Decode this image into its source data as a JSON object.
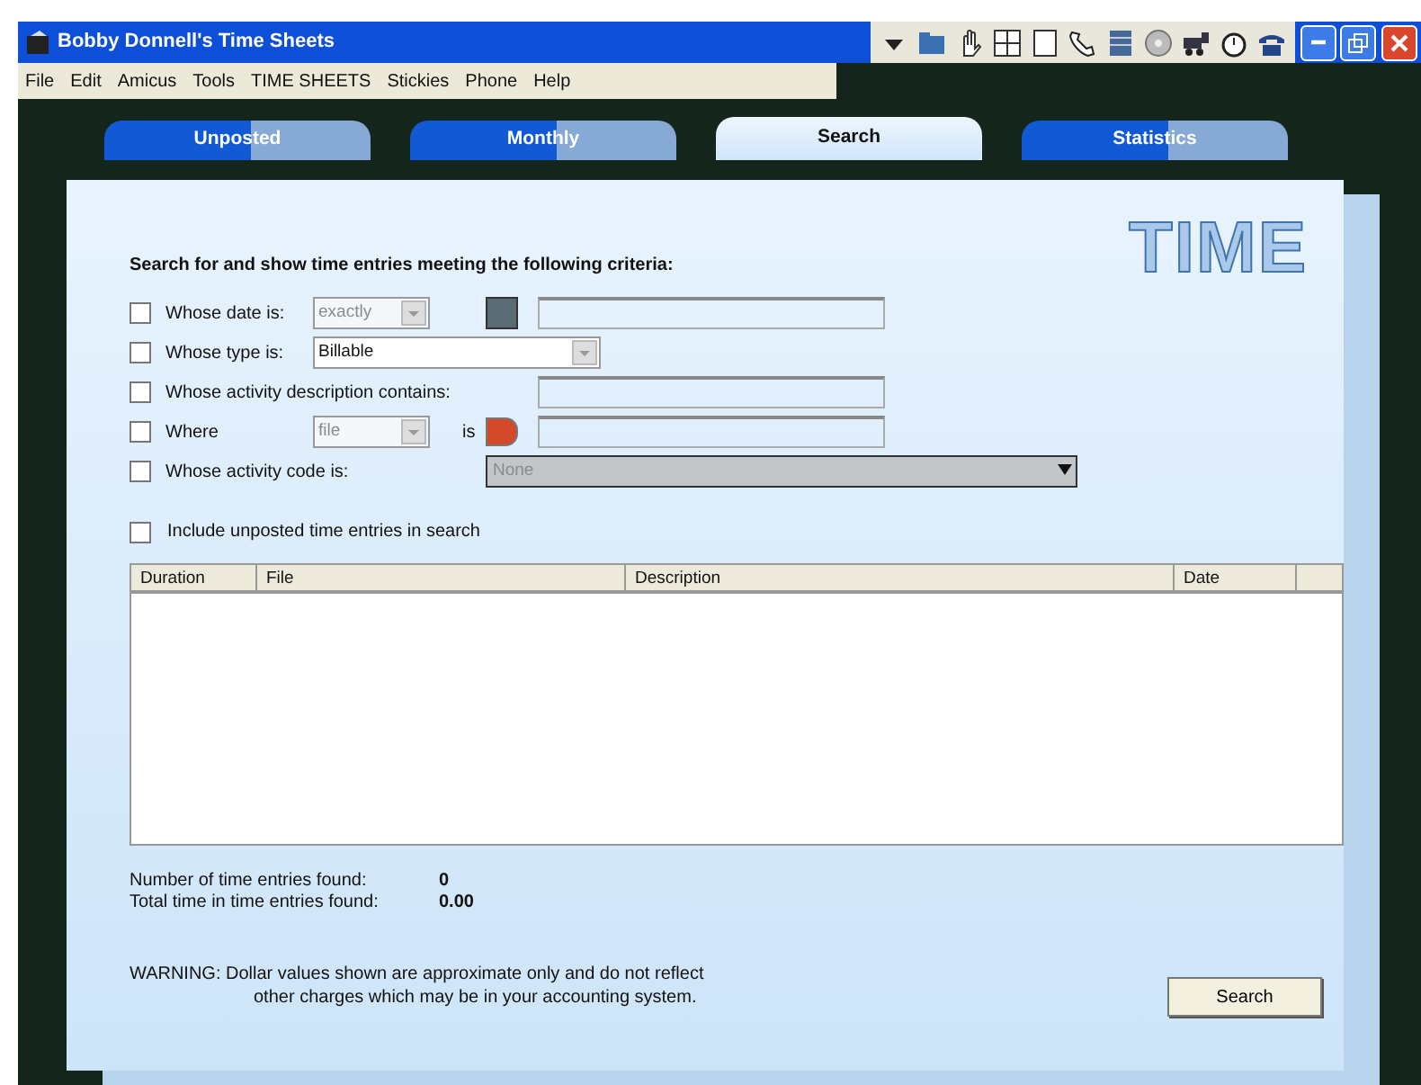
{
  "window": {
    "title": "Bobby Donnell's Time Sheets"
  },
  "toolbar": [
    {
      "kind": "dropdown"
    },
    {
      "kind": "folder"
    },
    {
      "kind": "hand"
    },
    {
      "kind": "panes"
    },
    {
      "kind": "page"
    },
    {
      "kind": "phone"
    },
    {
      "kind": "stack"
    },
    {
      "kind": "disk"
    },
    {
      "kind": "cart"
    },
    {
      "kind": "clock"
    },
    {
      "kind": "telephone"
    }
  ],
  "menu": [
    "File",
    "Edit",
    "Amicus",
    "Tools",
    "TIME SHEETS",
    "Stickies",
    "Phone",
    "Help"
  ],
  "tabs": [
    {
      "label": "Unposted",
      "selected": false
    },
    {
      "label": "Monthly",
      "selected": false
    },
    {
      "label": "Search",
      "selected": true
    },
    {
      "label": "Statistics",
      "selected": false
    }
  ],
  "logo": "TIME",
  "heading": "Search for and show time entries meeting the following criteria:",
  "criteria": [
    {
      "label": "Whose date is:",
      "checked": false,
      "controls": [
        {
          "kind": "select",
          "value": "exactly",
          "disabled": true
        },
        {
          "kind": "calendar"
        },
        {
          "kind": "input"
        }
      ]
    },
    {
      "label": "Whose type is:",
      "checked": false,
      "controls": [
        {
          "kind": "select",
          "value": "Billable",
          "disabled": false
        }
      ]
    },
    {
      "label": "Whose activity description contains:",
      "checked": false,
      "controls": [
        {
          "kind": "input"
        }
      ]
    },
    {
      "label": "Where",
      "checked": false,
      "controls": [
        {
          "kind": "select",
          "value": "file",
          "disabled": true
        },
        {
          "kind": "text",
          "value": "is"
        },
        {
          "kind": "tag"
        },
        {
          "kind": "input"
        }
      ]
    },
    {
      "label": "Whose activity code is:",
      "checked": false,
      "controls": [
        {
          "kind": "wide-select",
          "value": "None",
          "disabled": true
        }
      ]
    }
  ],
  "include_unposted": {
    "label": "Include unposted time entries in search",
    "checked": false
  },
  "table": {
    "columns": [
      "Duration",
      "File",
      "Description",
      "Date"
    ]
  },
  "stats": [
    {
      "label": "Number of time entries found:",
      "value": "0"
    },
    {
      "label": "Total time in time entries found:",
      "value": "0.00"
    }
  ],
  "warning": [
    "WARNING: Dollar values shown are approximate only and do not reflect",
    "other charges which may be in your accounting system."
  ],
  "search_button": "Search"
}
